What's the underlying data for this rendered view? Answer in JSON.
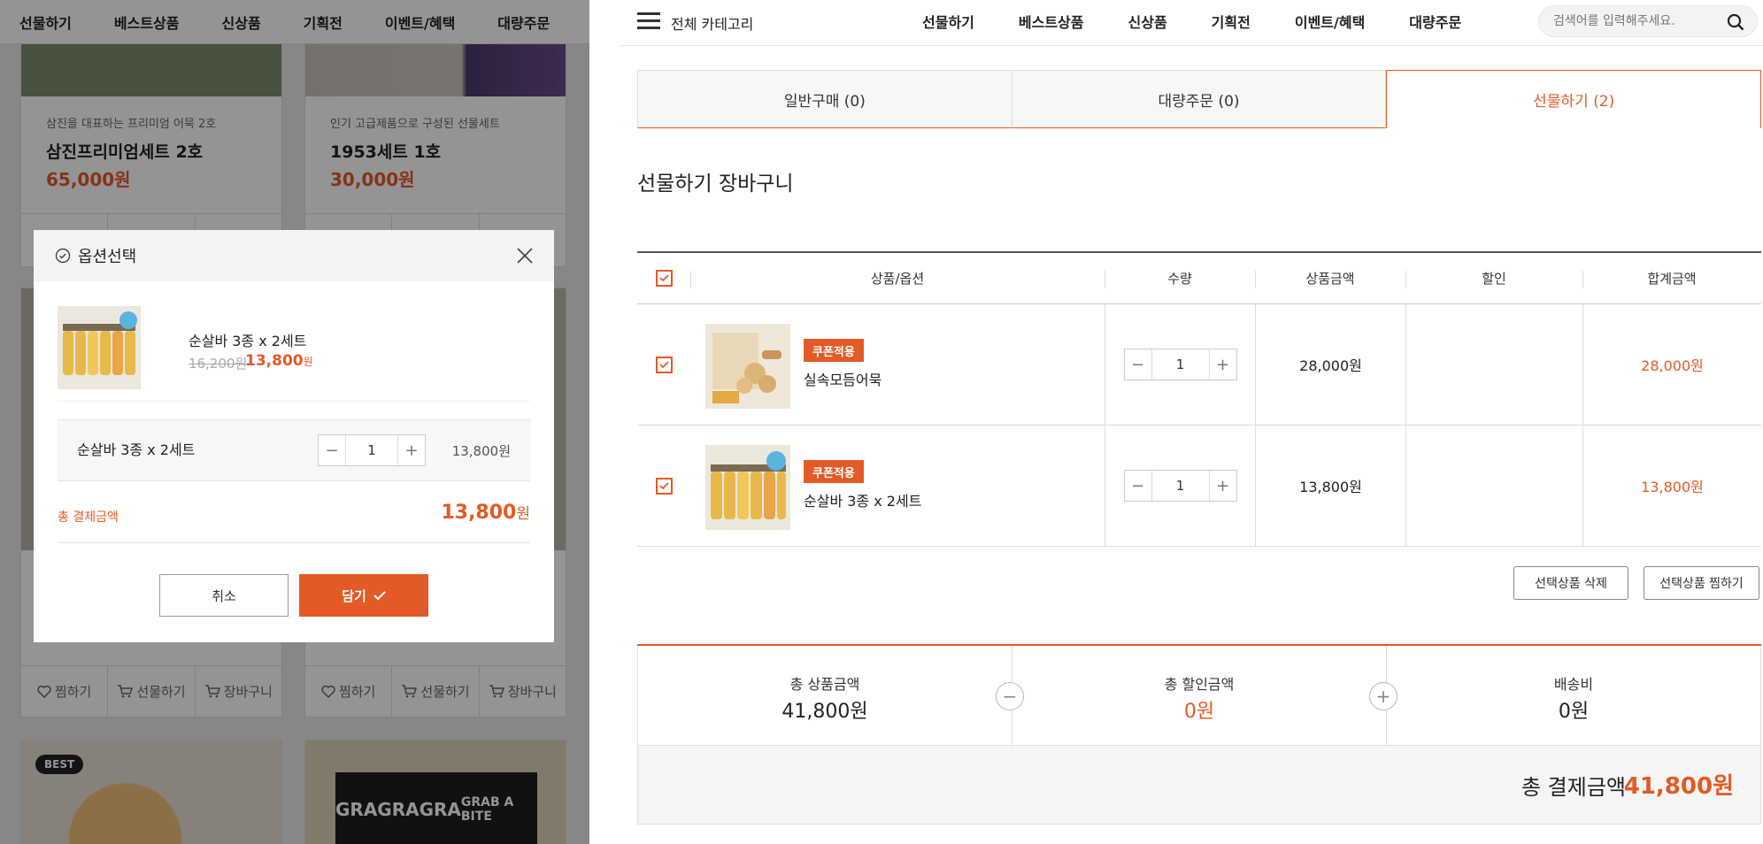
{
  "left": {
    "nav": [
      "선물하기",
      "베스트상품",
      "신상품",
      "기획전",
      "이벤트/혜택",
      "대량주문"
    ],
    "cards": [
      {
        "sub": "삼진을 대표하는 프리미엄 어묵 2호",
        "name": "삼진프리미엄세트 2호",
        "price": "65,000원"
      },
      {
        "sub": "인기 고급제품으로 구성된 선물세트",
        "name": "1953세트 1호",
        "price": "30,000원"
      }
    ],
    "card_buttons": {
      "wish": "찜하기",
      "gift": "선물하기",
      "cart": "장바구니"
    },
    "badge_best": "BEST",
    "grab_text": "GRAB A BITE",
    "grab_short": "GRA",
    "modal": {
      "title": "옵션선택",
      "product_name": "순살바 3종 x 2세트",
      "old_price": "16,200원",
      "new_price": "13,800",
      "won": "원",
      "option_name": "순살바 3종 x 2세트",
      "qty": "1",
      "option_price": "13,800원",
      "total_label": "총 결제금액",
      "total_value": "13,800",
      "cancel": "취소",
      "add": "담기"
    }
  },
  "right": {
    "all_category": "전체 카테고리",
    "menu": [
      "선물하기",
      "베스트상품",
      "신상품",
      "기획전",
      "이벤트/혜택",
      "대량주문"
    ],
    "search_placeholder": "검색어를 입력해주세요.",
    "tabs": [
      "일반구매 (0)",
      "대량주문 (0)",
      "선물하기 (2)"
    ],
    "page_title": "선물하기 장바구니",
    "columns": [
      "상품/옵션",
      "수량",
      "상품금액",
      "할인",
      "합계금액"
    ],
    "rows": [
      {
        "coupon": "쿠폰적용",
        "name": "실속모듬어묵",
        "qty": "1",
        "price": "28,000원",
        "discount": "",
        "total": "28,000원"
      },
      {
        "coupon": "쿠폰적용",
        "name": "순살바 3종 x 2세트",
        "qty": "1",
        "price": "13,800원",
        "discount": "",
        "total": "13,800원"
      }
    ],
    "delete_selected": "선택상품 삭제",
    "wish_selected": "선택상품 찜하기",
    "summary": {
      "product_total_label": "총 상품금액",
      "product_total": "41,800원",
      "discount_label": "총 할인금액",
      "discount": "0원",
      "shipping_label": "배송비",
      "shipping": "0원",
      "pay_label": "총 결제금액",
      "pay_total": "41,800원"
    }
  },
  "colors": {
    "accent": "#e35a26"
  }
}
